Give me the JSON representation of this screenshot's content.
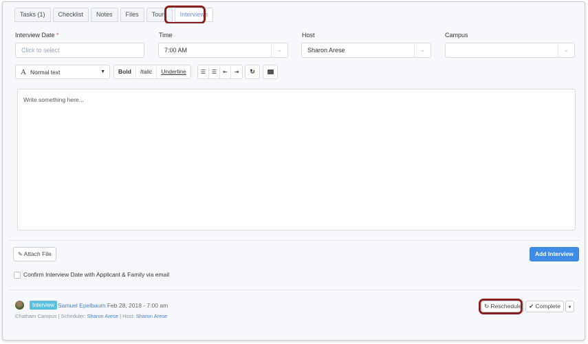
{
  "tabs": [
    {
      "label": "Tasks (1)"
    },
    {
      "label": "Checklist"
    },
    {
      "label": "Notes"
    },
    {
      "label": "Files"
    },
    {
      "label": "Tours"
    },
    {
      "label": "Interviews",
      "active": true
    }
  ],
  "form": {
    "interview_date": {
      "label": "Interview Date",
      "required_mark": "*",
      "placeholder": "Click to select"
    },
    "time": {
      "label": "Time",
      "value": "7:00 AM"
    },
    "host": {
      "label": "Host",
      "value": "Sharon Arese"
    },
    "campus": {
      "label": "Campus",
      "value": ""
    }
  },
  "toolbar": {
    "font_style": "Normal text",
    "font_icon": "A",
    "bold": "Bold",
    "italic": "Italic",
    "underline": "Underline",
    "icons": [
      "unordered-list-icon",
      "ordered-list-icon",
      "outdent-icon",
      "indent-icon",
      "redo-icon",
      "image-icon"
    ]
  },
  "editor": {
    "placeholder": "Write something here..."
  },
  "attach_file": {
    "icon": "paperclip-icon",
    "label": "Attach File"
  },
  "add_interview": {
    "label": "Add Interview"
  },
  "confirm": {
    "label": "Confirm Interview Date with Applicant & Family via email"
  },
  "interview": {
    "badge": "Interview",
    "applicant": "Samuel Epelbaum",
    "datetime": "Feb 28, 2018 - 7:00 am",
    "campus": "Chatham Campus",
    "scheduler_label": "Scheduler:",
    "scheduler": "Sharon Arese",
    "host_label": "Host:",
    "host": "Sharon Arese",
    "separator": "|",
    "reschedule": "Reschedule",
    "complete": "Complete"
  },
  "colors": {
    "accent": "#3f8ce6",
    "highlight": "#8a1f1f",
    "badge": "#5bc0de"
  }
}
